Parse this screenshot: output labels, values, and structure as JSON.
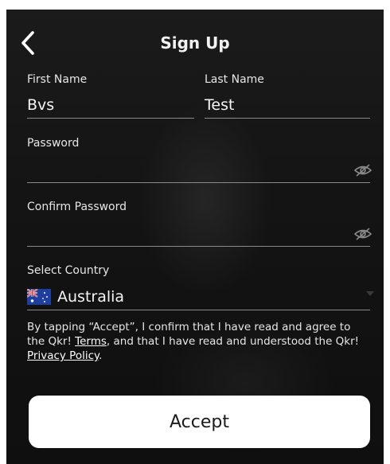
{
  "header": {
    "title": "Sign Up",
    "back_icon": "chevron-left-icon"
  },
  "form": {
    "first_name": {
      "label": "First Name",
      "value": "Bvs"
    },
    "last_name": {
      "label": "Last Name",
      "value": "Test"
    },
    "password": {
      "label": "Password",
      "value": "",
      "toggle_icon": "eye-slash-icon"
    },
    "confirm_password": {
      "label": "Confirm Password",
      "value": "",
      "toggle_icon": "eye-slash-icon"
    },
    "country": {
      "label": "Select Country",
      "value": "Australia",
      "flag_icon": "australia-flag-icon"
    }
  },
  "legal": {
    "line_pre": "By tapping “Accept”, I confirm that I have read and agree to the Qkr! ",
    "terms_link": "Terms",
    "line_mid": ", and that I have read and understood the Qkr! ",
    "privacy_link": "Privacy Policy",
    "line_end": "."
  },
  "actions": {
    "accept_label": "Accept"
  },
  "colors": {
    "background": "#141414",
    "text": "#ffffff",
    "underline": "#8a8a8a",
    "button_bg": "#ffffff",
    "button_text": "#1a1a1a"
  }
}
